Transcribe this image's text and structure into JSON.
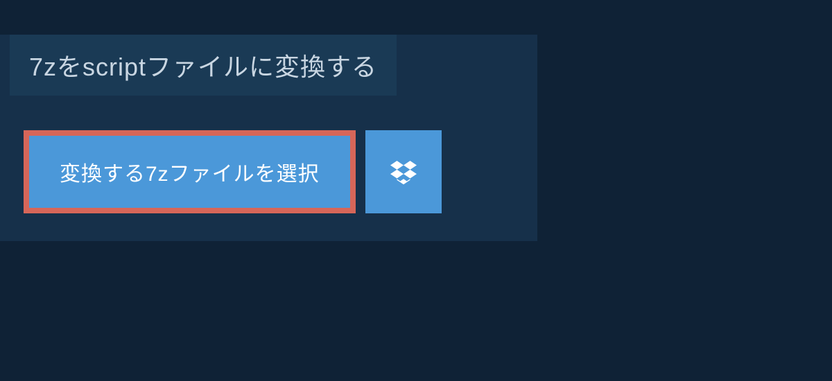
{
  "title": "7zをscriptファイルに変換する",
  "select_button_label": "変換する7zファイルを選択",
  "icons": {
    "dropbox": "dropbox-icon"
  },
  "colors": {
    "background": "#0f2236",
    "panel": "#16304a",
    "tab": "#1a3a55",
    "button": "#4b98d9",
    "highlight_border": "#d66659",
    "text_light": "#c9d6e2",
    "text_white": "#ffffff"
  }
}
